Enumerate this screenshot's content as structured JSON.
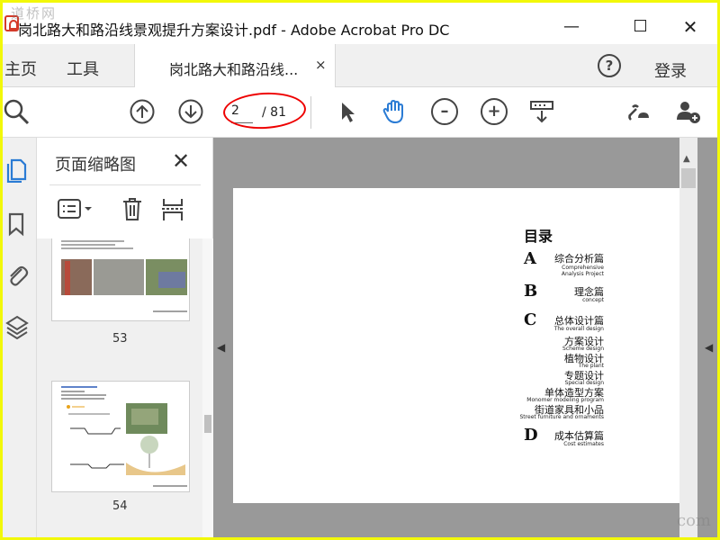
{
  "window": {
    "title": "岗北路大和路沿线景观提升方案设计.pdf - Adobe Acrobat Pro DC",
    "minimize": "—",
    "close": "✕"
  },
  "tabs": {
    "home": "主页",
    "tools": "工具",
    "document": "岗北路大和路沿线...",
    "document_close": "×",
    "help": "?",
    "login": "登录"
  },
  "toolbar": {
    "page_current": "2",
    "page_total": "/ 81"
  },
  "panel": {
    "title": "页面缩略图",
    "close": "✕",
    "thumbnails": [
      {
        "page": "53"
      },
      {
        "page": "54"
      }
    ]
  },
  "document": {
    "heading": "目录",
    "sections": [
      {
        "letter": "A",
        "items": [
          {
            "cn": "综合分析篇",
            "en": "Comprehensive Analysis Project"
          }
        ]
      },
      {
        "letter": "B",
        "items": [
          {
            "cn": "理念篇",
            "en": "concept"
          }
        ]
      },
      {
        "letter": "C",
        "items": [
          {
            "cn": "总体设计篇",
            "en": "The overall design"
          },
          {
            "cn": "方案设计",
            "en": "Scheme design"
          },
          {
            "cn": "植物设计",
            "en": "The plant"
          },
          {
            "cn": "专题设计",
            "en": "Special design"
          },
          {
            "cn": "单体造型方案",
            "en": "Monomer modeling program"
          },
          {
            "cn": "街道家具和小品",
            "en": "Street furniture and ornaments"
          }
        ]
      },
      {
        "letter": "D",
        "items": [
          {
            "cn": "成本估算篇",
            "en": "Cost estimates"
          }
        ]
      }
    ]
  },
  "colors": {
    "frame_border": "#f2f80a",
    "page_highlight": "#e00000",
    "hand_tool": "#2a7bd4",
    "sidebar_active": "#2a7bd4"
  }
}
